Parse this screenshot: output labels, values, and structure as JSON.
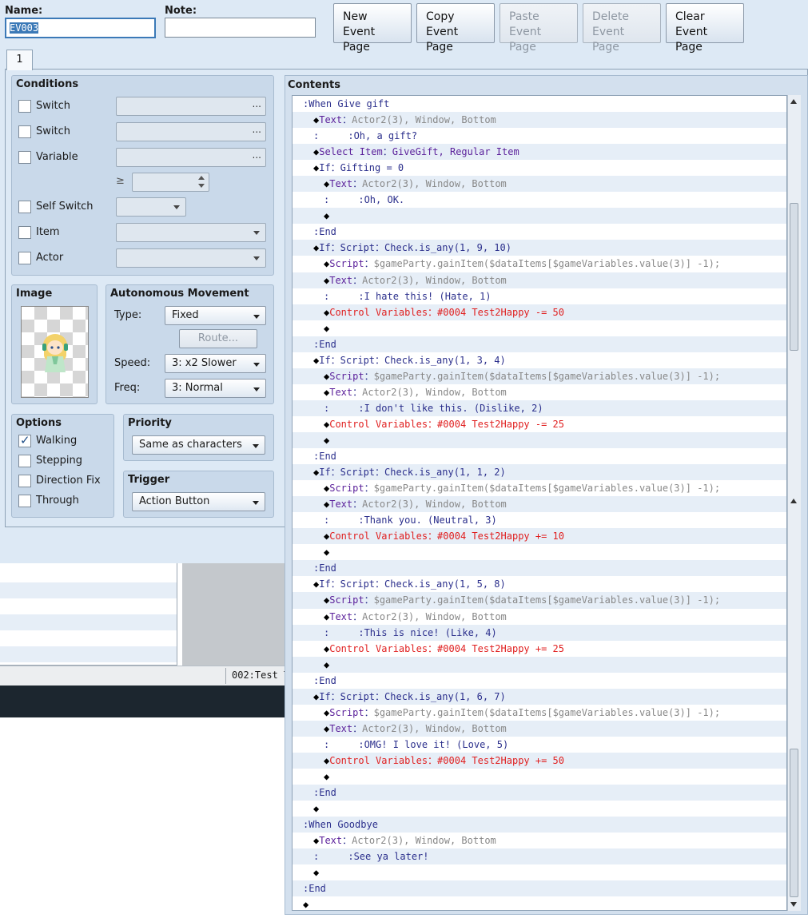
{
  "header": {
    "name_label": "Name:",
    "name_value": "EV003",
    "note_label": "Note:",
    "note_value": "",
    "buttons": [
      {
        "line1": "New",
        "line2": "Event Page",
        "disabled": false
      },
      {
        "line1": "Copy",
        "line2": "Event Page",
        "disabled": false
      },
      {
        "line1": "Paste",
        "line2": "Event Page",
        "disabled": true
      },
      {
        "line1": "Delete",
        "line2": "Event Page",
        "disabled": true
      },
      {
        "line1": "Clear",
        "line2": "Event Page",
        "disabled": false
      }
    ]
  },
  "tabs": [
    "1"
  ],
  "conditions": {
    "title": "Conditions",
    "switch1": "Switch",
    "switch2": "Switch",
    "variable": "Variable",
    "ge_symbol": "≥",
    "self_switch": "Self Switch",
    "item": "Item",
    "actor": "Actor",
    "dots": "..."
  },
  "image": {
    "title": "Image"
  },
  "movement": {
    "title": "Autonomous Movement",
    "type_label": "Type:",
    "type_value": "Fixed",
    "route_button": "Route...",
    "speed_label": "Speed:",
    "speed_value": "3: x2 Slower",
    "freq_label": "Freq:",
    "freq_value": "3: Normal"
  },
  "options": {
    "title": "Options",
    "walking": "Walking",
    "stepping": "Stepping",
    "direction_fix": "Direction Fix",
    "through": "Through"
  },
  "priority": {
    "title": "Priority",
    "value": "Same as characters"
  },
  "trigger": {
    "title": "Trigger",
    "value": "Action Button"
  },
  "contents": {
    "title": "Contents",
    "lines": [
      {
        "indent": 1,
        "parts": [
          {
            "c": "cmd",
            "t": ":When Give gift"
          }
        ]
      },
      {
        "indent": 2,
        "parts": [
          {
            "c": "blk",
            "t": "◆"
          },
          {
            "c": "purple",
            "t": "Text"
          },
          {
            "c": "cmd",
            "t": "："
          },
          {
            "c": "gray",
            "t": "Actor2(3), Window, Bottom"
          }
        ]
      },
      {
        "indent": 2,
        "parts": [
          {
            "c": "cmd",
            "t": ":     :"
          },
          {
            "c": "cmd",
            "t": "Oh, a gift?"
          }
        ]
      },
      {
        "indent": 2,
        "parts": [
          {
            "c": "blk",
            "t": "◆"
          },
          {
            "c": "purple",
            "t": "Select Item"
          },
          {
            "c": "cmd",
            "t": "："
          },
          {
            "c": "purple",
            "t": "GiveGift, Regular Item"
          }
        ]
      },
      {
        "indent": 2,
        "parts": [
          {
            "c": "blk",
            "t": "◆"
          },
          {
            "c": "cmd",
            "t": "If：Gifting = 0"
          }
        ]
      },
      {
        "indent": 3,
        "parts": [
          {
            "c": "blk",
            "t": "◆"
          },
          {
            "c": "purple",
            "t": "Text"
          },
          {
            "c": "cmd",
            "t": "："
          },
          {
            "c": "gray",
            "t": "Actor2(3), Window, Bottom"
          }
        ]
      },
      {
        "indent": 3,
        "parts": [
          {
            "c": "cmd",
            "t": ":     :"
          },
          {
            "c": "cmd",
            "t": "Oh, OK."
          }
        ]
      },
      {
        "indent": 3,
        "parts": [
          {
            "c": "blk",
            "t": "◆"
          }
        ]
      },
      {
        "indent": 2,
        "parts": [
          {
            "c": "cmd",
            "t": ":End"
          }
        ]
      },
      {
        "indent": 2,
        "parts": [
          {
            "c": "blk",
            "t": "◆"
          },
          {
            "c": "cmd",
            "t": "If：Script：Check.is_any(1, 9, 10)"
          }
        ]
      },
      {
        "indent": 3,
        "parts": [
          {
            "c": "blk",
            "t": "◆"
          },
          {
            "c": "purple",
            "t": "Script"
          },
          {
            "c": "cmd",
            "t": "："
          },
          {
            "c": "gray",
            "t": "$gameParty.gainItem($dataItems[$gameVariables.value(3)] -1);"
          }
        ]
      },
      {
        "indent": 3,
        "parts": [
          {
            "c": "blk",
            "t": "◆"
          },
          {
            "c": "purple",
            "t": "Text"
          },
          {
            "c": "cmd",
            "t": "："
          },
          {
            "c": "gray",
            "t": "Actor2(3), Window, Bottom"
          }
        ]
      },
      {
        "indent": 3,
        "parts": [
          {
            "c": "cmd",
            "t": ":     :"
          },
          {
            "c": "cmd",
            "t": "I hate this! (Hate, 1)"
          }
        ]
      },
      {
        "indent": 3,
        "parts": [
          {
            "c": "blk",
            "t": "◆"
          },
          {
            "c": "red",
            "t": "Control Variables：#0004 Test2Happy -= 50"
          }
        ]
      },
      {
        "indent": 3,
        "parts": [
          {
            "c": "blk",
            "t": "◆"
          }
        ]
      },
      {
        "indent": 2,
        "parts": [
          {
            "c": "cmd",
            "t": ":End"
          }
        ]
      },
      {
        "indent": 2,
        "parts": [
          {
            "c": "blk",
            "t": "◆"
          },
          {
            "c": "cmd",
            "t": "If：Script：Check.is_any(1, 3, 4)"
          }
        ]
      },
      {
        "indent": 3,
        "parts": [
          {
            "c": "blk",
            "t": "◆"
          },
          {
            "c": "purple",
            "t": "Script"
          },
          {
            "c": "cmd",
            "t": "："
          },
          {
            "c": "gray",
            "t": "$gameParty.gainItem($dataItems[$gameVariables.value(3)] -1);"
          }
        ]
      },
      {
        "indent": 3,
        "parts": [
          {
            "c": "blk",
            "t": "◆"
          },
          {
            "c": "purple",
            "t": "Text"
          },
          {
            "c": "cmd",
            "t": "："
          },
          {
            "c": "gray",
            "t": "Actor2(3), Window, Bottom"
          }
        ]
      },
      {
        "indent": 3,
        "parts": [
          {
            "c": "cmd",
            "t": ":     :"
          },
          {
            "c": "cmd",
            "t": "I don't like this. (Dislike, 2)"
          }
        ]
      },
      {
        "indent": 3,
        "parts": [
          {
            "c": "blk",
            "t": "◆"
          },
          {
            "c": "red",
            "t": "Control Variables：#0004 Test2Happy -= 25"
          }
        ]
      },
      {
        "indent": 3,
        "parts": [
          {
            "c": "blk",
            "t": "◆"
          }
        ]
      },
      {
        "indent": 2,
        "parts": [
          {
            "c": "cmd",
            "t": ":End"
          }
        ]
      },
      {
        "indent": 2,
        "parts": [
          {
            "c": "blk",
            "t": "◆"
          },
          {
            "c": "cmd",
            "t": "If：Script：Check.is_any(1, 1, 2)"
          }
        ]
      },
      {
        "indent": 3,
        "parts": [
          {
            "c": "blk",
            "t": "◆"
          },
          {
            "c": "purple",
            "t": "Script"
          },
          {
            "c": "cmd",
            "t": "："
          },
          {
            "c": "gray",
            "t": "$gameParty.gainItem($dataItems[$gameVariables.value(3)] -1);"
          }
        ]
      },
      {
        "indent": 3,
        "parts": [
          {
            "c": "blk",
            "t": "◆"
          },
          {
            "c": "purple",
            "t": "Text"
          },
          {
            "c": "cmd",
            "t": "："
          },
          {
            "c": "gray",
            "t": "Actor2(3), Window, Bottom"
          }
        ]
      },
      {
        "indent": 3,
        "parts": [
          {
            "c": "cmd",
            "t": ":     :"
          },
          {
            "c": "cmd",
            "t": "Thank you. (Neutral, 3)"
          }
        ]
      },
      {
        "indent": 3,
        "parts": [
          {
            "c": "blk",
            "t": "◆"
          },
          {
            "c": "red",
            "t": "Control Variables：#0004 Test2Happy += 10"
          }
        ]
      },
      {
        "indent": 3,
        "parts": [
          {
            "c": "blk",
            "t": "◆"
          }
        ]
      },
      {
        "indent": 2,
        "parts": [
          {
            "c": "cmd",
            "t": ":End"
          }
        ]
      },
      {
        "indent": 2,
        "parts": [
          {
            "c": "blk",
            "t": "◆"
          },
          {
            "c": "cmd",
            "t": "If：Script：Check.is_any(1, 5, 8)"
          }
        ]
      },
      {
        "indent": 3,
        "parts": [
          {
            "c": "blk",
            "t": "◆"
          },
          {
            "c": "purple",
            "t": "Script"
          },
          {
            "c": "cmd",
            "t": "："
          },
          {
            "c": "gray",
            "t": "$gameParty.gainItem($dataItems[$gameVariables.value(3)] -1);"
          }
        ]
      },
      {
        "indent": 3,
        "parts": [
          {
            "c": "blk",
            "t": "◆"
          },
          {
            "c": "purple",
            "t": "Text"
          },
          {
            "c": "cmd",
            "t": "："
          },
          {
            "c": "gray",
            "t": "Actor2(3), Window, Bottom"
          }
        ]
      },
      {
        "indent": 3,
        "parts": [
          {
            "c": "cmd",
            "t": ":     :"
          },
          {
            "c": "cmd",
            "t": "This is nice! (Like, 4)"
          }
        ]
      },
      {
        "indent": 3,
        "parts": [
          {
            "c": "blk",
            "t": "◆"
          },
          {
            "c": "red",
            "t": "Control Variables：#0004 Test2Happy += 25"
          }
        ]
      },
      {
        "indent": 3,
        "parts": [
          {
            "c": "blk",
            "t": "◆"
          }
        ]
      },
      {
        "indent": 2,
        "parts": [
          {
            "c": "cmd",
            "t": ":End"
          }
        ]
      },
      {
        "indent": 2,
        "parts": [
          {
            "c": "blk",
            "t": "◆"
          },
          {
            "c": "cmd",
            "t": "If：Script：Check.is_any(1, 6, 7)"
          }
        ]
      },
      {
        "indent": 3,
        "parts": [
          {
            "c": "blk",
            "t": "◆"
          },
          {
            "c": "purple",
            "t": "Script"
          },
          {
            "c": "cmd",
            "t": "："
          },
          {
            "c": "gray",
            "t": "$gameParty.gainItem($dataItems[$gameVariables.value(3)] -1);"
          }
        ]
      },
      {
        "indent": 3,
        "parts": [
          {
            "c": "blk",
            "t": "◆"
          },
          {
            "c": "purple",
            "t": "Text"
          },
          {
            "c": "cmd",
            "t": "："
          },
          {
            "c": "gray",
            "t": "Actor2(3), Window, Bottom"
          }
        ]
      },
      {
        "indent": 3,
        "parts": [
          {
            "c": "cmd",
            "t": ":     :"
          },
          {
            "c": "cmd",
            "t": "OMG! I love it! (Love, 5)"
          }
        ]
      },
      {
        "indent": 3,
        "parts": [
          {
            "c": "blk",
            "t": "◆"
          },
          {
            "c": "red",
            "t": "Control Variables：#0004 Test2Happy += 50"
          }
        ]
      },
      {
        "indent": 3,
        "parts": [
          {
            "c": "blk",
            "t": "◆"
          }
        ]
      },
      {
        "indent": 2,
        "parts": [
          {
            "c": "cmd",
            "t": ":End"
          }
        ]
      },
      {
        "indent": 2,
        "parts": [
          {
            "c": "blk",
            "t": "◆"
          }
        ]
      },
      {
        "indent": 1,
        "parts": [
          {
            "c": "cmd",
            "t": ":When Goodbye"
          }
        ]
      },
      {
        "indent": 2,
        "parts": [
          {
            "c": "blk",
            "t": "◆"
          },
          {
            "c": "purple",
            "t": "Text"
          },
          {
            "c": "cmd",
            "t": "："
          },
          {
            "c": "gray",
            "t": "Actor2(3), Window, Bottom"
          }
        ]
      },
      {
        "indent": 2,
        "parts": [
          {
            "c": "cmd",
            "t": ":     :"
          },
          {
            "c": "cmd",
            "t": "See ya later!"
          }
        ]
      },
      {
        "indent": 2,
        "parts": [
          {
            "c": "blk",
            "t": "◆"
          }
        ]
      },
      {
        "indent": 1,
        "parts": [
          {
            "c": "cmd",
            "t": ":End"
          }
        ]
      },
      {
        "indent": 1,
        "parts": [
          {
            "c": "blk",
            "t": "◆"
          }
        ]
      }
    ]
  },
  "background": {
    "status_text": "002:Test T"
  },
  "colors": {
    "panel": "#dde9f5",
    "group": "#c9d9ea",
    "command": "#2b2f8c",
    "comment_gray": "#888888",
    "control_red": "#e01f1f",
    "accent": "#3b79b7"
  }
}
